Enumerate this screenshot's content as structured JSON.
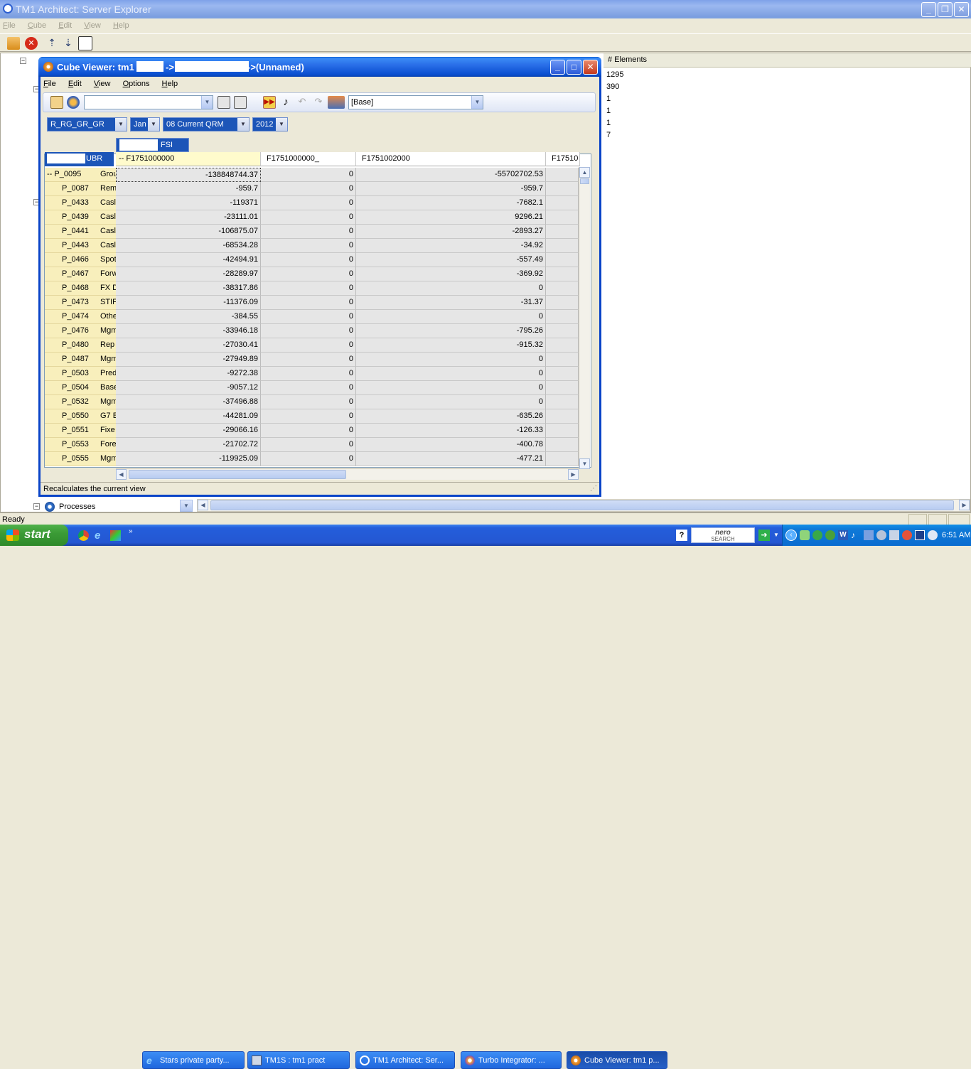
{
  "outer": {
    "title": "TM1 Architect: Server Explorer",
    "menu": [
      "File",
      "Cube",
      "Edit",
      "View",
      "Help"
    ],
    "status": "Ready",
    "panel_header": "# Elements",
    "element_counts": [
      "1295",
      "390",
      "1",
      "1",
      "1",
      "7"
    ],
    "processes_label": "Processes"
  },
  "cube": {
    "title_prefix": "Cube Viewer: tm1",
    "title_suffix": "->(Unnamed)",
    "menu": [
      "File",
      "Edit",
      "View",
      "Options",
      "Help"
    ],
    "view_combo": "[Base]",
    "titles": [
      {
        "value": "R_RG_GR_GR"
      },
      {
        "value": "Jan"
      },
      {
        "value": "08 Current QRM"
      },
      {
        "value": "2012"
      }
    ],
    "column_dim": "FSI",
    "row_dim": "UBR",
    "columns": [
      "-- F1751000000",
      "F1751000000_",
      "F1751002000",
      "F17510"
    ],
    "rows": [
      {
        "code": "-- P_0095",
        "name": "Group",
        "v": [
          "-138848744.37",
          "0",
          "-55702702.53"
        ]
      },
      {
        "code": "P_0087",
        "name": "Rem",
        "v": [
          "-959.7",
          "0",
          "-959.7"
        ]
      },
      {
        "code": "P_0433",
        "name": "Casl",
        "v": [
          "-119371",
          "0",
          "-7682.1"
        ]
      },
      {
        "code": "P_0439",
        "name": "Casl",
        "v": [
          "-23111.01",
          "0",
          "9296.21"
        ]
      },
      {
        "code": "P_0441",
        "name": "Casl",
        "v": [
          "-106875.07",
          "0",
          "-2893.27"
        ]
      },
      {
        "code": "P_0443",
        "name": "Casl",
        "v": [
          "-68534.28",
          "0",
          "-34.92"
        ]
      },
      {
        "code": "P_0466",
        "name": "Spot",
        "v": [
          "-42494.91",
          "0",
          "-557.49"
        ]
      },
      {
        "code": "P_0467",
        "name": "Forw",
        "v": [
          "-28289.97",
          "0",
          "-369.92"
        ]
      },
      {
        "code": "P_0468",
        "name": "FX D",
        "v": [
          "-38317.86",
          "0",
          "0"
        ]
      },
      {
        "code": "P_0473",
        "name": "STIF",
        "v": [
          "-11376.09",
          "0",
          "-31.37"
        ]
      },
      {
        "code": "P_0474",
        "name": "Othe",
        "v": [
          "-384.55",
          "0",
          "0"
        ]
      },
      {
        "code": "P_0476",
        "name": "Mgm",
        "v": [
          "-33946.18",
          "0",
          "-795.26"
        ]
      },
      {
        "code": "P_0480",
        "name": "Rep",
        "v": [
          "-27030.41",
          "0",
          "-915.32"
        ]
      },
      {
        "code": "P_0487",
        "name": "Mgm",
        "v": [
          "-27949.89",
          "0",
          "0"
        ]
      },
      {
        "code": "P_0503",
        "name": "Pred",
        "v": [
          "-9272.38",
          "0",
          "0"
        ]
      },
      {
        "code": "P_0504",
        "name": "Base",
        "v": [
          "-9057.12",
          "0",
          "0"
        ]
      },
      {
        "code": "P_0532",
        "name": "Mgm",
        "v": [
          "-37496.88",
          "0",
          "0"
        ]
      },
      {
        "code": "P_0550",
        "name": "G7 E",
        "v": [
          "-44281.09",
          "0",
          "-635.26"
        ]
      },
      {
        "code": "P_0551",
        "name": "Fixe",
        "v": [
          "-29066.16",
          "0",
          "-126.33"
        ]
      },
      {
        "code": "P_0553",
        "name": "Fore",
        "v": [
          "-21702.72",
          "0",
          "-400.78"
        ]
      },
      {
        "code": "P_0555",
        "name": "Mgm",
        "v": [
          "-119925.09",
          "0",
          "-477.21"
        ]
      }
    ],
    "status": "Recalculates the current view"
  },
  "taskbar": {
    "start": "start",
    "tasks": [
      {
        "label": "Stars private party..."
      },
      {
        "label": "TM1S : tm1 pract"
      },
      {
        "label": "TM1 Architect: Ser..."
      },
      {
        "label": "Turbo Integrator: ..."
      },
      {
        "label": "Cube Viewer: tm1 p..."
      }
    ],
    "search_label": "nero",
    "search_sub": "SEARCH",
    "clock": "6:51 AM"
  }
}
